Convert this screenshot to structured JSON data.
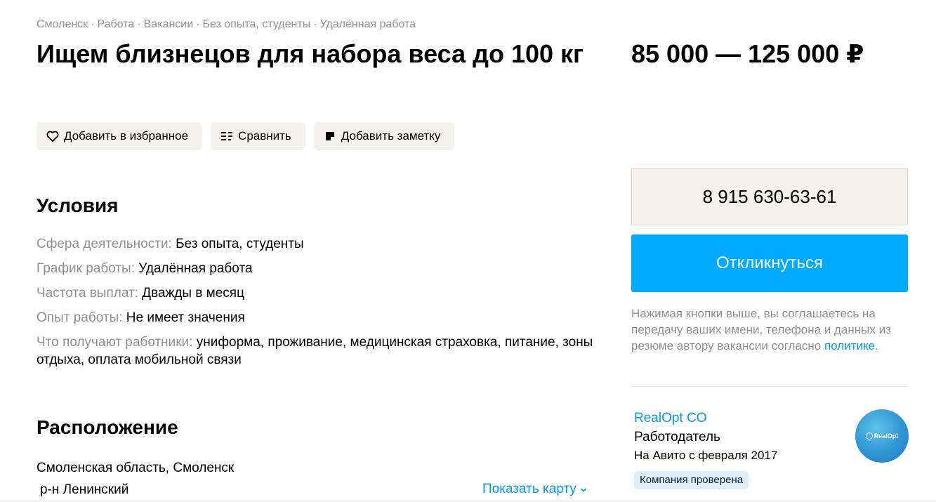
{
  "breadcrumb": [
    "Смоленск",
    "Работа",
    "Вакансии",
    "Без опыта, студенты",
    "Удалённая работа"
  ],
  "breadcrumb_sep": "·",
  "title": "Ищем близнецов для набора веса до 100 кг",
  "price": "85 000 — 125 000 ₽",
  "actions": {
    "favorite": "Добавить в избранное",
    "compare": "Сравнить",
    "note": "Добавить заметку"
  },
  "conditions": {
    "heading": "Условия",
    "rows": [
      {
        "label": "Сфера деятельности:",
        "value": "Без опыта, студенты"
      },
      {
        "label": "График работы:",
        "value": "Удалённая работа"
      },
      {
        "label": "Частота выплат:",
        "value": "Дважды в месяц"
      },
      {
        "label": "Опыт работы:",
        "value": "Не имеет значения"
      },
      {
        "label": "Что получают работники:",
        "value": "униформа, проживание, медицинская страховка, питание, зоны отдыха, оплата мобильной связи"
      }
    ]
  },
  "location": {
    "heading": "Расположение",
    "region": "Смоленская область, Смоленск",
    "district": "р-н Ленинский",
    "map_link": "Показать карту"
  },
  "contact": {
    "phone": "8 915 630-63-61",
    "respond": "Откликнуться",
    "agree_text": "Нажимая кнопки выше, вы соглашаетесь на передачу ваших имени, телефона и данных из резюме автору вакансии согласно",
    "agree_link": "политике",
    "agree_end": "."
  },
  "seller": {
    "name": "RealOpt CO",
    "role": "Работодатель",
    "since": "На Авито с февраля 2017",
    "badge": "Компания проверена",
    "avatar_text": "RealOpt"
  },
  "colors": {
    "accent": "#00aaff",
    "link": "#0099f7",
    "muted": "#8f8f8f",
    "button_bg": "#f2f1ed"
  }
}
